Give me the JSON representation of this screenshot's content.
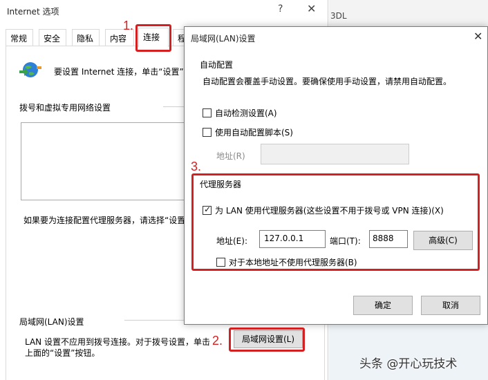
{
  "bg_window": {
    "title": "Internet 选项",
    "help": "?",
    "close": "✕",
    "tabs": [
      "常规",
      "安全",
      "隐私",
      "内容",
      "连接",
      "程"
    ],
    "setup_text": "要设置 Internet 连接，单击“设置”。",
    "dialup_heading": "拨号和虚拟专用网络设置",
    "dialup_hint": "如果要为连接配置代理服务器，请选择“设置”",
    "lan_heading": "局域网(LAN)设置",
    "lan_note_1": "LAN 设置不应用到拨号连接。对于拨号设置，单击",
    "lan_note_2": "上面的“设置”按钮。",
    "lan_settings_button": "局域网设置(L)"
  },
  "side_window": {
    "text": "3DL"
  },
  "annotations": {
    "step1": "1.",
    "step2": "2.",
    "step3": "3."
  },
  "lan_dialog": {
    "title": "局域网(LAN)设置",
    "close": "✕",
    "auto_config_heading": "自动配置",
    "auto_config_desc": "自动配置会覆盖手动设置。要确保使用手动设置，请禁用自动配置。",
    "auto_detect_label": "自动检测设置(A)",
    "auto_detect_checked": false,
    "auto_script_label": "使用自动配置脚本(S)",
    "auto_script_checked": false,
    "script_address_label": "地址(R)",
    "script_address_value": "",
    "proxy_heading": "代理服务器",
    "use_proxy_label": "为 LAN 使用代理服务器(这些设置不用于拨号或 VPN 连接)(X)",
    "use_proxy_checked": true,
    "address_label": "地址(E):",
    "address_value": "127.0.0.1",
    "port_label": "端口(T):",
    "port_value": "8888",
    "advanced_button": "高级(C)",
    "bypass_label": "对于本地地址不使用代理服务器(B)",
    "bypass_checked": false,
    "ok_button": "确定",
    "cancel_button": "取消"
  },
  "watermark": "头条 @开心玩技术",
  "colors": {
    "annotation_red": "#d42020",
    "button_bg": "#e1e1e1"
  }
}
